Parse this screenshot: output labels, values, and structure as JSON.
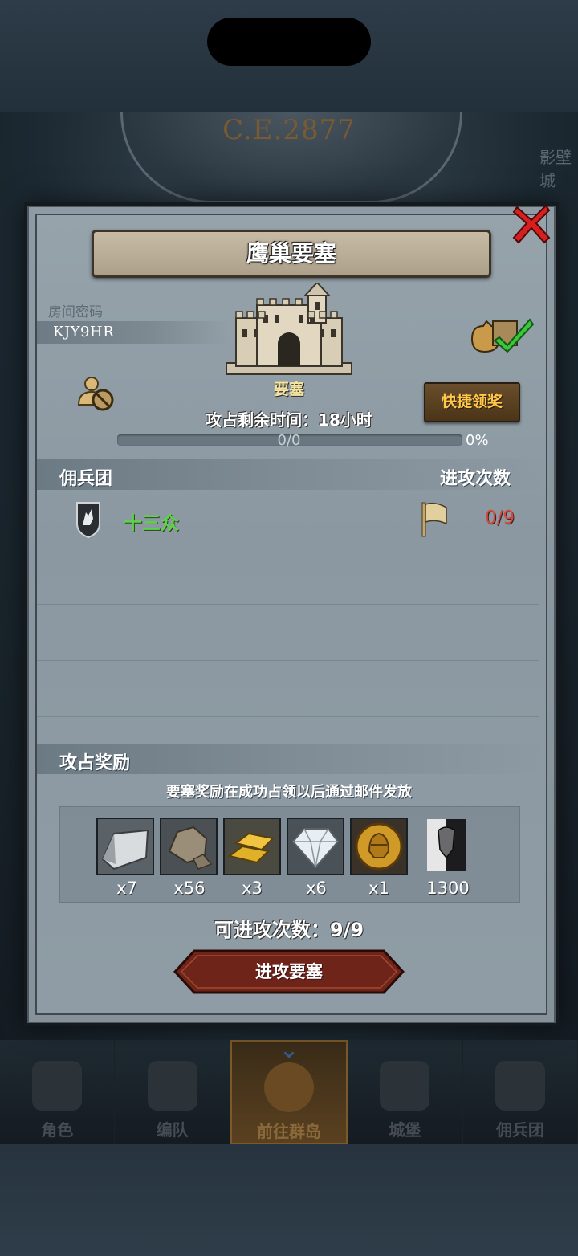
{
  "era": "C.E.2877",
  "side_label": "影壁城",
  "dialog": {
    "title": "鹰巢要塞",
    "room_label": "房间密码",
    "room_code": "KJY9HR",
    "fortress_type": "要塞",
    "quick_claim_label": "快捷领奖",
    "time_left": "攻占剩余时间：18小时",
    "progress": {
      "text": "0/0",
      "percent_text": "0%",
      "fraction": 0
    },
    "mercenary_section": {
      "title": "佣兵团",
      "right_label": "进攻次数",
      "rows": [
        {
          "name": "十三众",
          "attacks": "0/9"
        }
      ]
    },
    "reward_section": {
      "title": "攻占奖励",
      "note": "要塞奖励在成功占领以后通过邮件发放",
      "items": [
        {
          "icon": "silver-ingot-icon",
          "qty": "x7"
        },
        {
          "icon": "ore-rock-icon",
          "qty": "x56"
        },
        {
          "icon": "gold-bars-icon",
          "qty": "x3"
        },
        {
          "icon": "diamond-icon",
          "qty": "x6"
        },
        {
          "icon": "knight-medal-icon",
          "qty": "x1"
        },
        {
          "icon": "bull-banner-icon",
          "qty": "1300"
        }
      ]
    },
    "attacks_available": "可进攻次数：9/9",
    "attack_button_label": "进攻要塞"
  },
  "bottom_nav": [
    {
      "label": "角色",
      "icon": "knight-icon",
      "active": false
    },
    {
      "label": "编队",
      "icon": "helmet-icon",
      "active": false
    },
    {
      "label": "前往群岛",
      "icon": "compass-icon",
      "active": true
    },
    {
      "label": "城堡",
      "icon": "castle-icon",
      "active": false
    },
    {
      "label": "佣兵团",
      "icon": "ship-icon",
      "active": false
    }
  ],
  "colors": {
    "guild_name": "#5fd24a",
    "attack_count": "#d14a3c",
    "fortress_type": "#f5e3a0",
    "quick_claim_text": "#ffc84a"
  }
}
